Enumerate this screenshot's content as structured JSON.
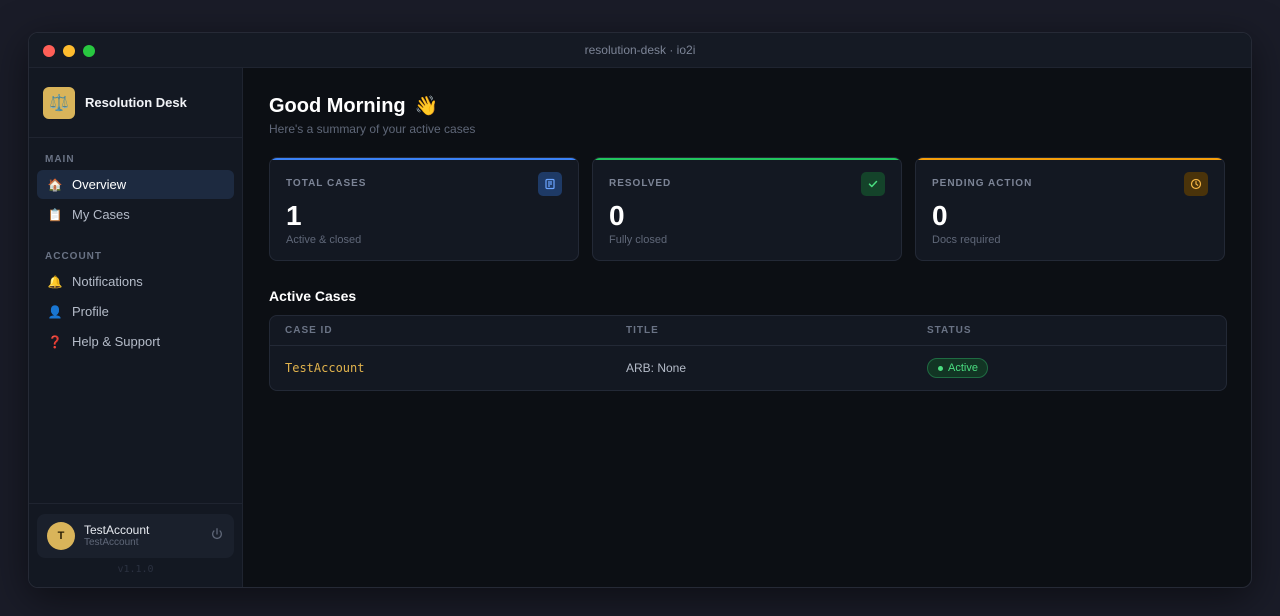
{
  "window": {
    "title": "resolution-desk · io2i"
  },
  "brand": {
    "name": "Resolution Desk",
    "logo_icon": "⚖️"
  },
  "sidebar": {
    "main_heading": "MAIN",
    "main_items": [
      {
        "label": "Overview",
        "icon": "🏠",
        "active": true
      },
      {
        "label": "My Cases",
        "icon": "📋",
        "active": false
      }
    ],
    "account_heading": "ACCOUNT",
    "account_items": [
      {
        "label": "Notifications",
        "icon": "🔔"
      },
      {
        "label": "Profile",
        "icon": "👤"
      },
      {
        "label": "Help & Support",
        "icon": "❓"
      }
    ]
  },
  "user": {
    "initial": "T",
    "name": "TestAccount",
    "sub": "TestAccount",
    "version": "v1.1.0"
  },
  "main": {
    "greeting": "Good Morning",
    "wave": "👋",
    "subtitle": "Here's a summary of your active cases",
    "cards": [
      {
        "label": "TOTAL CASES",
        "value": "1",
        "sub": "Active & closed",
        "accent": "#3b82f6"
      },
      {
        "label": "RESOLVED",
        "value": "0",
        "sub": "Fully closed",
        "accent": "#22c55e"
      },
      {
        "label": "PENDING ACTION",
        "value": "0",
        "sub": "Docs required",
        "accent": "#f59e0b"
      }
    ],
    "section_title": "Active Cases",
    "table": {
      "headers": [
        "CASE ID",
        "TITLE",
        "STATUS"
      ],
      "rows": [
        {
          "case_id": "TestAccount",
          "title": "ARB: None",
          "status": "Active"
        }
      ]
    }
  }
}
